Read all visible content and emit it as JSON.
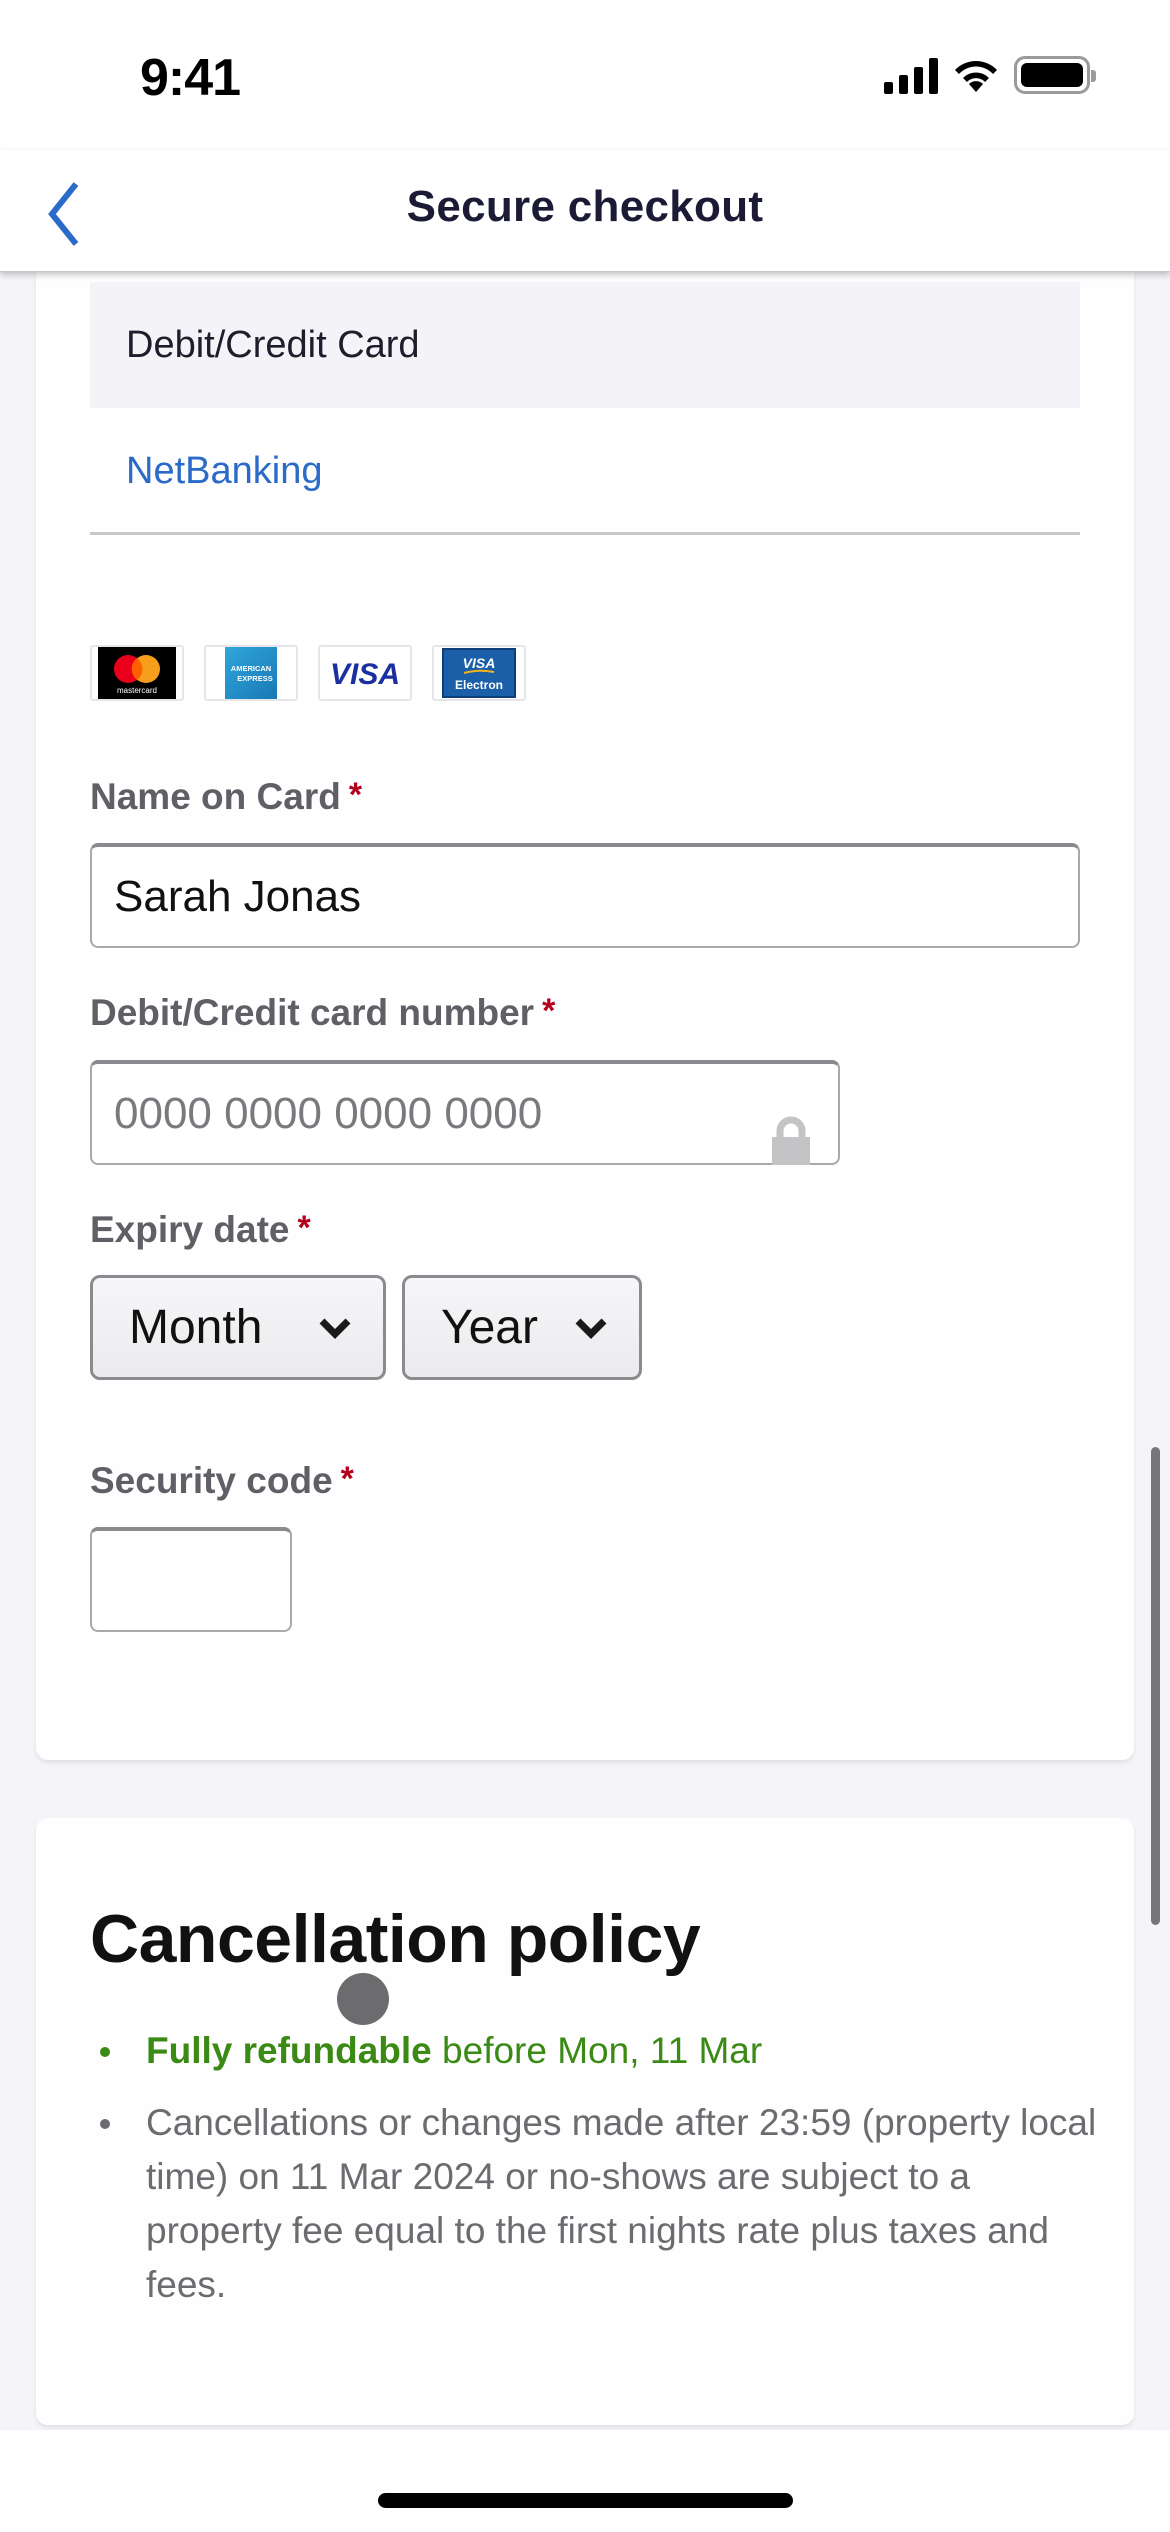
{
  "status_bar": {
    "time": "9:41"
  },
  "nav": {
    "title": "Secure checkout",
    "back_icon": "chevron-left-icon"
  },
  "colors": {
    "accent_blue": "#2a6ac8",
    "required_red": "#b3001b",
    "refund_green": "#3a8a14",
    "page_bg": "#f5f4f8"
  },
  "payment": {
    "tabs": [
      {
        "label": "Debit/Credit Card",
        "active": true
      },
      {
        "label": "NetBanking",
        "active": false
      }
    ],
    "card_logos": [
      {
        "name": "mastercard",
        "text": "mastercard"
      },
      {
        "name": "american-express",
        "text": "AMERICAN EXPRESS"
      },
      {
        "name": "visa",
        "text": "VISA"
      },
      {
        "name": "visa-electron",
        "text": "VISA Electron"
      }
    ],
    "name_on_card": {
      "label": "Name on Card",
      "required_mark": "*",
      "value": "Sarah Jonas"
    },
    "card_number": {
      "label": "Debit/Credit card number",
      "required_mark": "*",
      "placeholder": "0000 0000 0000 0000"
    },
    "expiry": {
      "label": "Expiry date",
      "required_mark": "*",
      "month": {
        "selected": "Month"
      },
      "year": {
        "selected": "Year"
      }
    },
    "security_code": {
      "label": "Security code",
      "required_mark": "*",
      "value": ""
    }
  },
  "cancellation": {
    "title": "Cancellation policy",
    "items": [
      {
        "bold": "Fully refundable",
        "text": " before Mon, 11 Mar"
      },
      {
        "text": "Cancellations or changes made after 23:59 (property local time) on 11 Mar 2024 or no-shows are subject to a property fee equal to the first nights rate plus taxes and fees."
      }
    ]
  }
}
